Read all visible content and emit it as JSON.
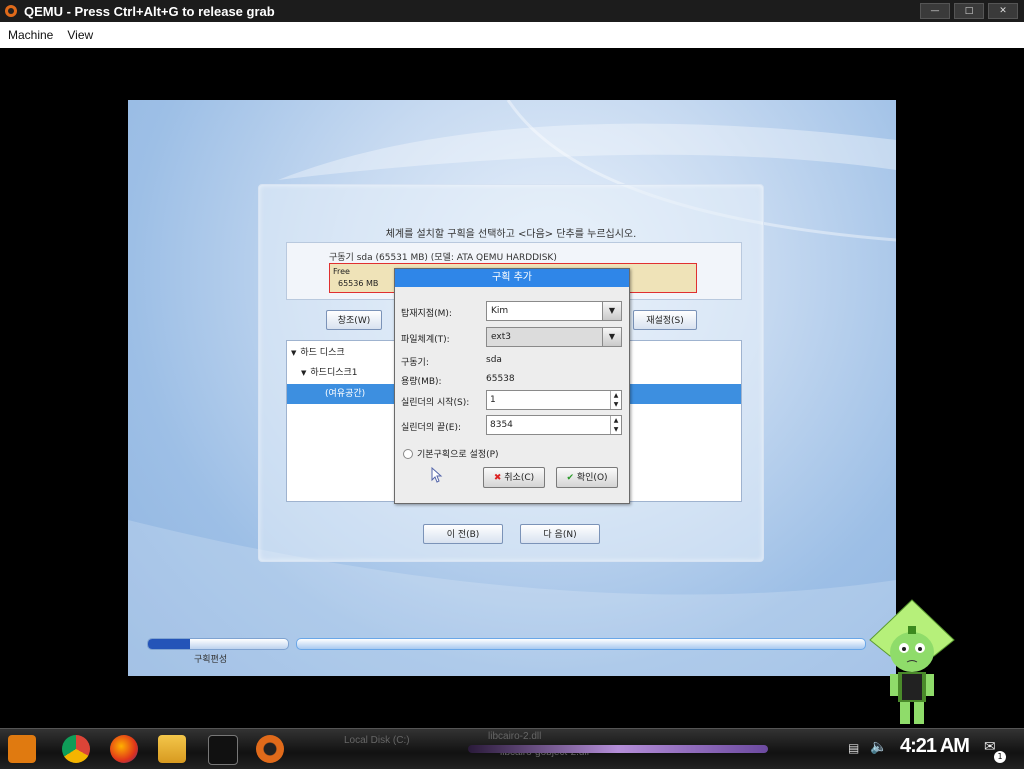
{
  "host": {
    "title": "QEMU - Press Ctrl+Alt+G to release grab",
    "menu": [
      "Machine",
      "View"
    ]
  },
  "installer": {
    "instruction": "체계를 설치할 구획을 선택하고 <다음> 단추를 누르십시오.",
    "drive_title": "구동기 sda (65531 MB) (모델: ATA QEMU HARDDISK)",
    "free_label": "Free",
    "free_size": "65536 MB",
    "btn_browse": "창조(W)",
    "btn_reset": "재설정(S)",
    "tree": [
      "하드 디스크",
      "하드디스크1",
      "(여유공간)"
    ],
    "btn_prev": "이 전(B)",
    "btn_next": "다 음(N)",
    "progress_label": "구획편성",
    "progress_fraction": 0.3
  },
  "dialog": {
    "title": "구획 추가",
    "mount_label": "탑재지점(M):",
    "mount_value": "Kim",
    "fs_label": "파일체계(T):",
    "fs_value": "ext3",
    "drive_label": "구동기:",
    "drive_value": "sda",
    "capacity_label": "용량(MB):",
    "capacity_value": "65538",
    "start_label": "실린더의 시작(S):",
    "start_value": "1",
    "end_label": "실린더의 끝(E):",
    "end_value": "8354",
    "primary_label": "기본구획으로 설정(P)",
    "cancel": "취소(C)",
    "ok": "확인(O)"
  },
  "taskbar": {
    "clock": "4:21 AM",
    "window_a": "Local Disk (C:)",
    "window_b": "libcairo-gobject-2.dll",
    "window_c": "libcairo-2.dll",
    "notification_count": "1"
  }
}
